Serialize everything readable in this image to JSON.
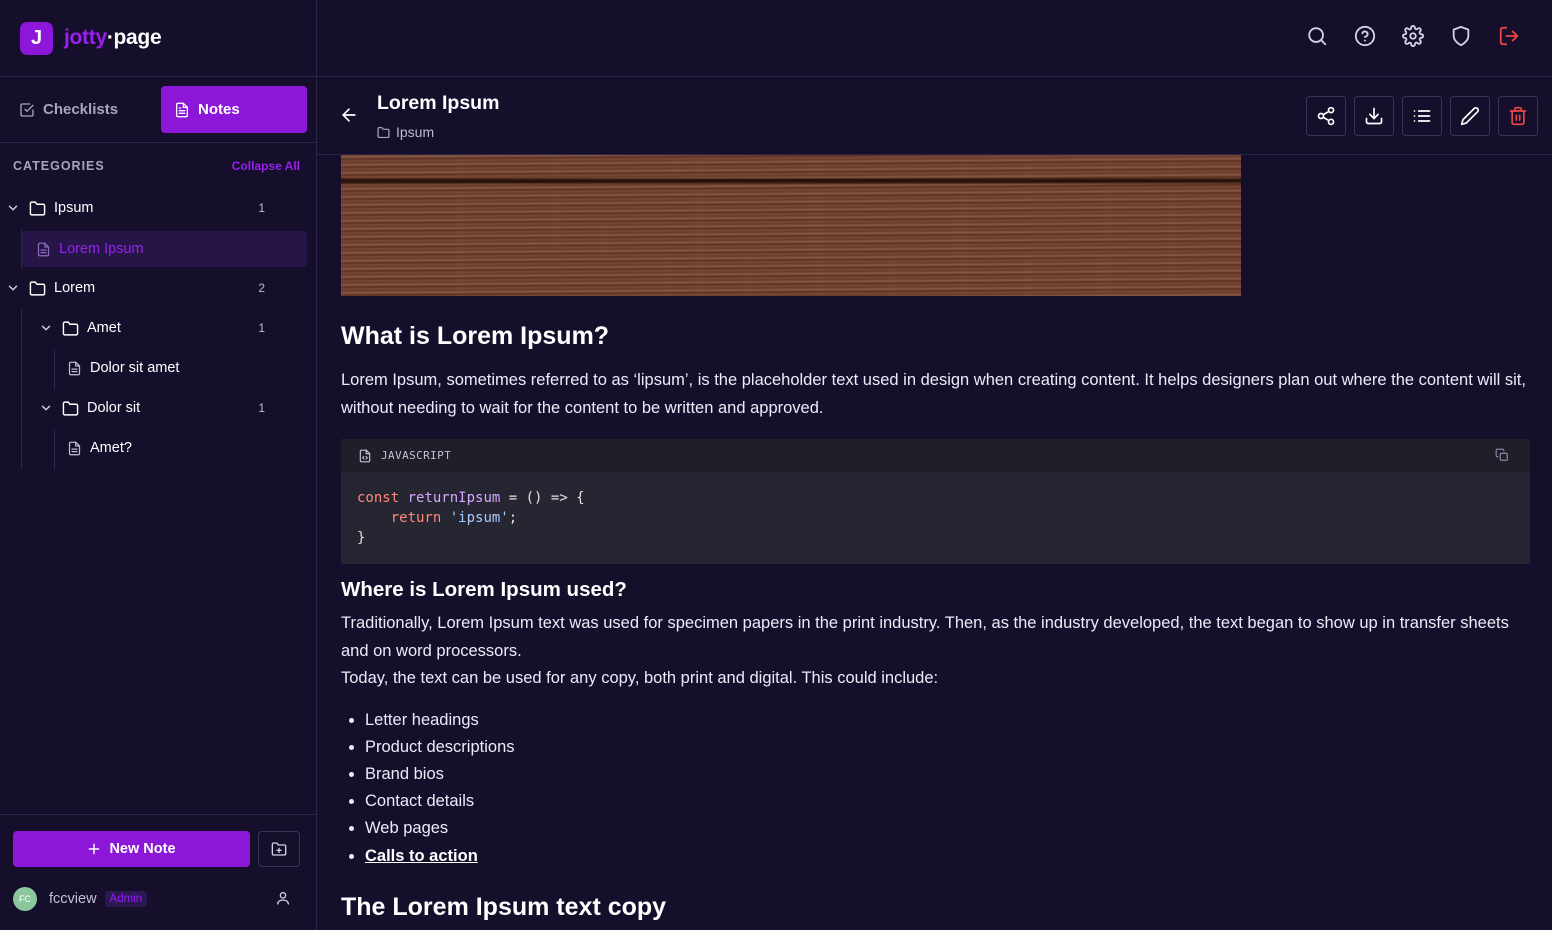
{
  "brand": {
    "logo_letter": "J",
    "name_part1": "jotty",
    "name_part2": "·page"
  },
  "mode_tabs": [
    {
      "label": "Checklists",
      "icon": "checkbox-icon",
      "active": false
    },
    {
      "label": "Notes",
      "icon": "document-icon",
      "active": true
    }
  ],
  "categories": {
    "title": "CATEGORIES",
    "collapse_label": "Collapse All",
    "tree": [
      {
        "label": "Ipsum",
        "type": "folder",
        "count": "1"
      },
      {
        "label": "Lorem Ipsum",
        "type": "note",
        "selected": true
      },
      {
        "label": "Lorem",
        "type": "folder",
        "count": "2"
      },
      {
        "label": "Amet",
        "type": "folder",
        "count": "1"
      },
      {
        "label": "Dolor sit amet",
        "type": "note"
      },
      {
        "label": "Dolor sit",
        "type": "folder",
        "count": "1"
      },
      {
        "label": "Amet?",
        "type": "note"
      }
    ]
  },
  "sidebar_bottom": {
    "new_note_label": "New Note",
    "user": {
      "initials": "FC",
      "name": "fccview",
      "role": "Admin"
    }
  },
  "topbar_icons": [
    "search-icon",
    "help-icon",
    "settings-icon",
    "shield-icon",
    "logout-icon"
  ],
  "note": {
    "title": "Lorem Ipsum",
    "category": "Ipsum",
    "actions": [
      "share-icon",
      "download-icon",
      "list-icon",
      "edit-icon",
      "trash-icon"
    ]
  },
  "content": {
    "heading1": "What is Lorem Ipsum?",
    "para1": "Lorem Ipsum, sometimes referred to as ‘lipsum’, is the placeholder text used in design when creating content. It helps designers plan out where the content will sit, without needing to wait for the content to be written and approved.",
    "code": {
      "language": "JAVASCRIPT",
      "line1_kw": "const",
      "line1_fn": "returnIpsum",
      "line1_rest": " = () => {",
      "line2_kw": "return",
      "line2_str": "'ipsum'",
      "line2_rest": ";",
      "line3": "}"
    },
    "heading2": "Where is Lorem Ipsum used?",
    "para2": "Traditionally, Lorem Ipsum text was used for specimen papers in the print industry. Then, as the industry developed, the text began to show up in transfer sheets and on word processors.",
    "para3": "Today, the text can be used for any copy, both print and digital. This could include:",
    "bullets": [
      "Letter headings",
      "Product descriptions",
      "Brand bios",
      "Contact details",
      "Web pages",
      "Calls to action"
    ],
    "heading3": "The Lorem Ipsum text copy"
  },
  "colors": {
    "accent": "#8c17d9",
    "background": "#150f2c",
    "danger": "#ef4444"
  }
}
